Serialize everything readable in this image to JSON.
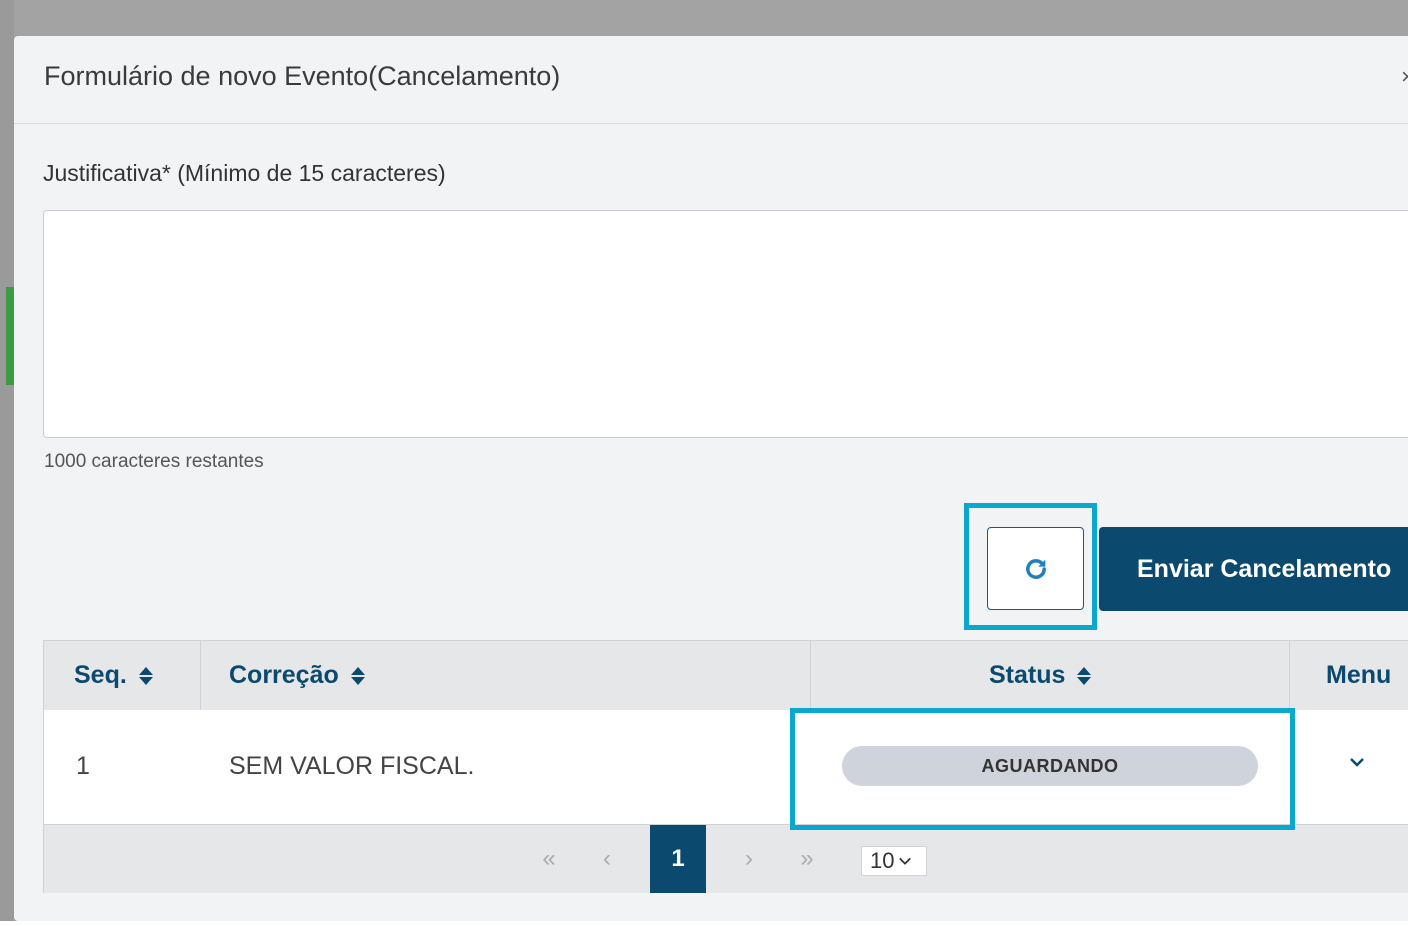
{
  "modal": {
    "title": "Formulário de novo Evento(Cancelamento)",
    "close_glyph": "×"
  },
  "form": {
    "justification_label": "Justificativa* (Mínimo de 15 caracteres)",
    "justification_value": "",
    "char_count": "1000 caracteres restantes"
  },
  "actions": {
    "refresh_icon": "refresh-icon",
    "send_label": "Enviar Cancelamento"
  },
  "table": {
    "headers": [
      "Seq.",
      "Correção",
      "Status",
      "Menu"
    ],
    "rows": [
      {
        "seq": "1",
        "correcao": "SEM VALOR FISCAL.",
        "status": "AGUARDANDO"
      }
    ]
  },
  "pagination": {
    "first": "«",
    "prev": "‹",
    "current_page": "1",
    "next": "›",
    "last": "»",
    "page_size": "10"
  },
  "colors": {
    "primary": "#0b4a6e",
    "highlight": "#0aa7cf",
    "badge_bg": "#cfd3db"
  }
}
